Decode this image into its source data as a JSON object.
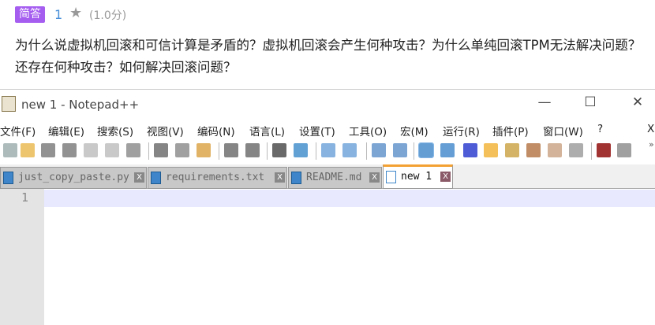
{
  "question": {
    "type_badge": "简答",
    "number": "1",
    "score": "(1.0分)",
    "text": "为什么说虚拟机回滚和可信计算是矛盾的？虚拟机回滚会产生何种攻击？为什么单纯回滚TPM无法解决问题？还存在何种攻击？如何解决回滚问题？"
  },
  "window": {
    "title": "new 1 - Notepad++",
    "minimize": "—",
    "maximize": "☐",
    "close": "✕"
  },
  "menu": [
    "文件(F)",
    "编辑(E)",
    "搜索(S)",
    "视图(V)",
    "编码(N)",
    "语言(L)",
    "设置(T)",
    "工具(O)",
    "宏(M)",
    "运行(R)",
    "插件(P)",
    "窗口(W)",
    "?",
    "X"
  ],
  "toolbar_icons": [
    "new-file",
    "open",
    "save",
    "save-all",
    "close",
    "close-all",
    "print",
    "cut",
    "copy",
    "paste",
    "undo",
    "redo",
    "find",
    "replace",
    "zoom-in",
    "zoom-out",
    "sync-vertical",
    "sync-horizontal",
    "word-wrap",
    "show-all-chars",
    "indent-guide",
    "user-defined-language",
    "document-map",
    "function-list",
    "folder-workspace",
    "monitoring",
    "record-macro",
    "stop-recording",
    "overflow"
  ],
  "tabs": [
    {
      "label": "just_copy_paste.py"
    },
    {
      "label": "requirements.txt"
    },
    {
      "label": "README.md"
    },
    {
      "label": "new 1",
      "active": true
    }
  ],
  "editor": {
    "line_numbers": [
      "1"
    ]
  }
}
